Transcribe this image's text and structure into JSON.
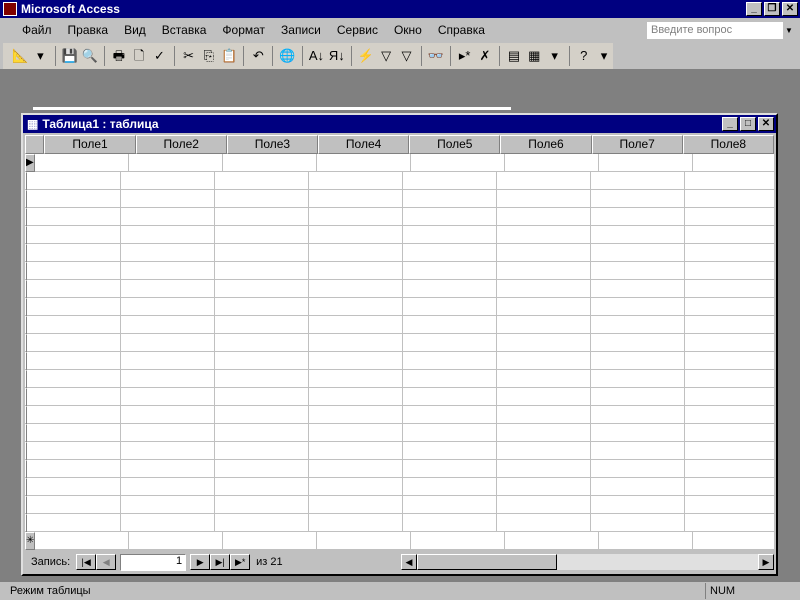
{
  "app": {
    "title": "Microsoft Access"
  },
  "menu": [
    "Файл",
    "Правка",
    "Вид",
    "Вставка",
    "Формат",
    "Записи",
    "Сервис",
    "Окно",
    "Справка"
  ],
  "ask": {
    "placeholder": "Введите вопрос"
  },
  "toolbar": [
    {
      "name": "view-design-icon",
      "g": "📐"
    },
    {
      "name": "dropdown-arrow-icon",
      "g": "▾"
    },
    {
      "sep": true
    },
    {
      "name": "save-icon",
      "g": "💾"
    },
    {
      "name": "search-web-icon",
      "g": "🔍"
    },
    {
      "sep": true
    },
    {
      "name": "print-icon",
      "g": "🖶"
    },
    {
      "name": "print-preview-icon",
      "g": "🗋"
    },
    {
      "name": "spelling-icon",
      "g": "✓"
    },
    {
      "sep": true
    },
    {
      "name": "cut-icon",
      "g": "✂"
    },
    {
      "name": "copy-icon",
      "g": "⎘"
    },
    {
      "name": "paste-icon",
      "g": "📋"
    },
    {
      "sep": true
    },
    {
      "name": "undo-icon",
      "g": "↶"
    },
    {
      "sep": true
    },
    {
      "name": "hyperlink-icon",
      "g": "🌐"
    },
    {
      "sep": true
    },
    {
      "name": "sort-ascending-icon",
      "g": "A↓"
    },
    {
      "name": "sort-descending-icon",
      "g": "Я↓"
    },
    {
      "sep": true
    },
    {
      "name": "filter-by-selection-icon",
      "g": "⚡"
    },
    {
      "name": "filter-by-form-icon",
      "g": "▽"
    },
    {
      "name": "apply-filter-icon",
      "g": "▽"
    },
    {
      "sep": true
    },
    {
      "name": "find-icon",
      "g": "👓"
    },
    {
      "sep": true
    },
    {
      "name": "new-record-icon",
      "g": "▸*"
    },
    {
      "name": "delete-record-icon",
      "g": "✗"
    },
    {
      "sep": true
    },
    {
      "name": "database-window-icon",
      "g": "▤"
    },
    {
      "name": "new-object-icon",
      "g": "▦"
    },
    {
      "name": "dropdown-arrow-icon",
      "g": "▾"
    },
    {
      "sep": true
    },
    {
      "name": "help-icon",
      "g": "?"
    },
    {
      "name": "dropdown-arrow-icon",
      "g": "▾"
    }
  ],
  "table_window": {
    "title": "Таблица1 : таблица",
    "columns": [
      "Поле1",
      "Поле2",
      "Поле3",
      "Поле4",
      "Поле5",
      "Поле6",
      "Поле7",
      "Поле8"
    ],
    "row_count": 21,
    "current_marker": "▶",
    "new_marker": "✳"
  },
  "nav": {
    "label": "Запись:",
    "current": "1",
    "of": "из  21"
  },
  "status": {
    "mode": "Режим таблицы",
    "num": "NUM"
  }
}
